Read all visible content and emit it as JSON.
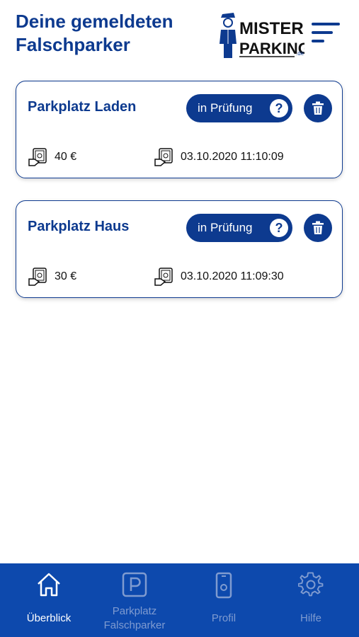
{
  "header": {
    "title_line1": "Deine gemeldeten",
    "title_line2": "Falschparker",
    "logo_line1": "MISTER",
    "logo_line2": "PARKING",
    "logo_suffix": ".de"
  },
  "reports": [
    {
      "title": "Parkplatz Laden",
      "status": "in Prüfung",
      "amount": "40 €",
      "datetime": "03.10.2020 11:10:09"
    },
    {
      "title": "Parkplatz Haus",
      "status": "in Prüfung",
      "amount": "30 €",
      "datetime": "03.10.2020 11:09:30"
    }
  ],
  "nav": {
    "items": [
      {
        "label": "Überblick",
        "icon": "home-icon",
        "active": true
      },
      {
        "label_line1": "Parkplatz",
        "label_line2": "Falschparker",
        "icon": "parking-icon",
        "active": false
      },
      {
        "label": "Profil",
        "icon": "phone-icon",
        "active": false
      },
      {
        "label": "Hilfe",
        "icon": "gear-icon",
        "active": false
      }
    ]
  },
  "colors": {
    "primary": "#0d3a8f",
    "nav_bg": "#0d49ad",
    "nav_active": "#ffffff",
    "nav_inactive": "#7f9bd0"
  }
}
